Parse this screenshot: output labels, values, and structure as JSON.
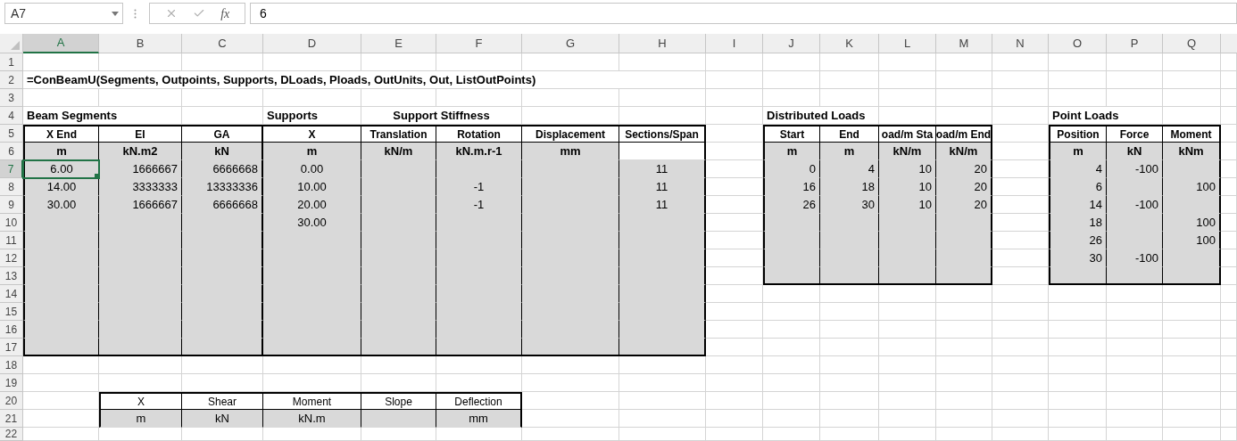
{
  "formula_bar": {
    "name_box": "A7",
    "fx": "fx",
    "value": "6"
  },
  "columns": [
    {
      "label": "A",
      "selected": true
    },
    {
      "label": "B",
      "selected": false
    },
    {
      "label": "C",
      "selected": false
    },
    {
      "label": "D",
      "selected": false
    },
    {
      "label": "E",
      "selected": false
    },
    {
      "label": "F",
      "selected": false
    },
    {
      "label": "G",
      "selected": false
    },
    {
      "label": "H",
      "selected": false
    },
    {
      "label": "I",
      "selected": false
    },
    {
      "label": "J",
      "selected": false
    },
    {
      "label": "K",
      "selected": false
    },
    {
      "label": "L",
      "selected": false
    },
    {
      "label": "M",
      "selected": false
    },
    {
      "label": "N",
      "selected": false
    },
    {
      "label": "O",
      "selected": false
    },
    {
      "label": "P",
      "selected": false
    },
    {
      "label": "Q",
      "selected": false
    }
  ],
  "rows": [
    {
      "label": "1",
      "selected": false
    },
    {
      "label": "2",
      "selected": false
    },
    {
      "label": "3",
      "selected": false
    },
    {
      "label": "4",
      "selected": false
    },
    {
      "label": "5",
      "selected": false
    },
    {
      "label": "6",
      "selected": false
    },
    {
      "label": "7",
      "selected": true
    },
    {
      "label": "8",
      "selected": false
    },
    {
      "label": "9",
      "selected": false
    },
    {
      "label": "10",
      "selected": false
    },
    {
      "label": "11",
      "selected": false
    },
    {
      "label": "12",
      "selected": false
    },
    {
      "label": "13",
      "selected": false
    },
    {
      "label": "14",
      "selected": false
    },
    {
      "label": "15",
      "selected": false
    },
    {
      "label": "16",
      "selected": false
    },
    {
      "label": "17",
      "selected": false
    },
    {
      "label": "18",
      "selected": false
    },
    {
      "label": "19",
      "selected": false
    },
    {
      "label": "20",
      "selected": false
    },
    {
      "label": "21",
      "selected": false
    },
    {
      "label": "22",
      "selected": false
    }
  ],
  "formula_text": "=ConBeamU(Segments, Outpoints, Supports, DLoads, Ploads, OutUnits, Out, ListOutPoints)",
  "tables": [
    {
      "kind": "input",
      "titles": [
        "Beam Segments"
      ],
      "columns": [
        {
          "header": "X End",
          "unit": "m"
        },
        {
          "header": "EI",
          "unit": "kN.m2"
        },
        {
          "header": "GA",
          "unit": "kN"
        }
      ],
      "rows": [
        [
          "6.00",
          "1666667",
          "6666668"
        ],
        [
          "14.00",
          "3333333",
          "13333336"
        ],
        [
          "30.00",
          "1666667",
          "6666668"
        ]
      ]
    },
    {
      "kind": "input",
      "titles": [
        "Supports",
        "Support Stiffness"
      ],
      "columns": [
        {
          "header": "X",
          "unit": "m"
        },
        {
          "header": "Translation",
          "unit": "kN/m"
        },
        {
          "header": "Rotation",
          "unit": "kN.m.r-1"
        },
        {
          "header": "Displacement",
          "unit": "mm"
        },
        {
          "header": "Sections/Span",
          "unit_shaded": false
        }
      ],
      "rows": [
        [
          "0.00",
          null,
          null,
          null,
          "11"
        ],
        [
          "10.00",
          null,
          "-1",
          null,
          "11"
        ],
        [
          "20.00",
          null,
          "-1",
          null,
          "11"
        ],
        [
          "30.00",
          null,
          null,
          null,
          null
        ]
      ]
    },
    {
      "kind": "input",
      "titles": [
        "Distributed Loads"
      ],
      "columns": [
        {
          "header": "Start",
          "unit": "m"
        },
        {
          "header": "End",
          "unit": "m"
        },
        {
          "header": "oad/m Sta",
          "unit": "kN/m"
        },
        {
          "header": "oad/m End",
          "unit": "kN/m"
        }
      ],
      "rows": [
        [
          "0",
          "4",
          "10",
          "20"
        ],
        [
          "16",
          "18",
          "10",
          "20"
        ],
        [
          "26",
          "30",
          "10",
          "20"
        ]
      ]
    },
    {
      "kind": "input",
      "titles": [
        "Point Loads"
      ],
      "columns": [
        {
          "header": "Position",
          "unit": "m"
        },
        {
          "header": "Force",
          "unit": "kN"
        },
        {
          "header": "Moment",
          "unit": "kNm"
        }
      ],
      "rows": [
        [
          "4",
          "-100",
          null
        ],
        [
          "6",
          null,
          "100"
        ],
        [
          "14",
          "-100",
          null
        ],
        [
          "18",
          null,
          "100"
        ],
        [
          "26",
          null,
          "100"
        ],
        [
          "30",
          "-100",
          null
        ]
      ]
    },
    {
      "kind": "output",
      "columns": [
        {
          "header": "X",
          "unit": "m"
        },
        {
          "header": "Shear",
          "unit": "kN"
        },
        {
          "header": "Moment",
          "unit": "kN.m"
        },
        {
          "header": "Slope"
        },
        {
          "header": "Deflection",
          "unit": "mm"
        }
      ]
    }
  ]
}
